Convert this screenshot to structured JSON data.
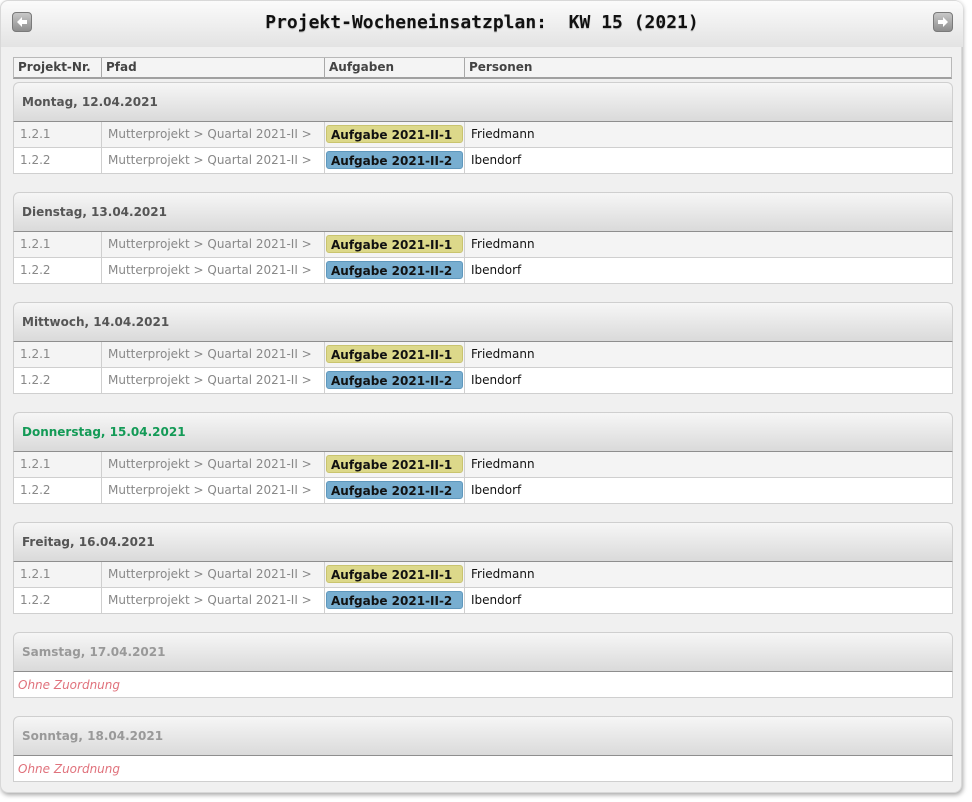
{
  "header": {
    "title": "Projekt-Wocheneinsatzplan:  KW 15 (2021)"
  },
  "columns": [
    "Projekt-Nr.",
    "Pfad",
    "Aufgaben",
    "Personen"
  ],
  "colors": {
    "today": "#139a56",
    "empty_text": "#e0727c",
    "task_yellow": "#dcd88a",
    "task_blue": "#78aed0"
  },
  "days": [
    {
      "label": "Montag, 12.04.2021",
      "rows": [
        {
          "nr": "1.2.1",
          "pfad": "Mutterprojekt > Quartal 2021-II >",
          "aufgabe": "Aufgabe 2021-II-1",
          "person": "Friedmann"
        },
        {
          "nr": "1.2.2",
          "pfad": "Mutterprojekt > Quartal 2021-II >",
          "aufgabe": "Aufgabe 2021-II-2",
          "person": "Ibendorf"
        }
      ]
    },
    {
      "label": "Dienstag, 13.04.2021",
      "rows": [
        {
          "nr": "1.2.1",
          "pfad": "Mutterprojekt > Quartal 2021-II >",
          "aufgabe": "Aufgabe 2021-II-1",
          "person": "Friedmann"
        },
        {
          "nr": "1.2.2",
          "pfad": "Mutterprojekt > Quartal 2021-II >",
          "aufgabe": "Aufgabe 2021-II-2",
          "person": "Ibendorf"
        }
      ]
    },
    {
      "label": "Mittwoch, 14.04.2021",
      "rows": [
        {
          "nr": "1.2.1",
          "pfad": "Mutterprojekt > Quartal 2021-II >",
          "aufgabe": "Aufgabe 2021-II-1",
          "person": "Friedmann"
        },
        {
          "nr": "1.2.2",
          "pfad": "Mutterprojekt > Quartal 2021-II >",
          "aufgabe": "Aufgabe 2021-II-2",
          "person": "Ibendorf"
        }
      ]
    },
    {
      "label": "Donnerstag, 15.04.2021",
      "rows": [
        {
          "nr": "1.2.1",
          "pfad": "Mutterprojekt > Quartal 2021-II >",
          "aufgabe": "Aufgabe 2021-II-1",
          "person": "Friedmann"
        },
        {
          "nr": "1.2.2",
          "pfad": "Mutterprojekt > Quartal 2021-II >",
          "aufgabe": "Aufgabe 2021-II-2",
          "person": "Ibendorf"
        }
      ]
    },
    {
      "label": "Freitag, 16.04.2021",
      "rows": [
        {
          "nr": "1.2.1",
          "pfad": "Mutterprojekt > Quartal 2021-II >",
          "aufgabe": "Aufgabe 2021-II-1",
          "person": "Friedmann"
        },
        {
          "nr": "1.2.2",
          "pfad": "Mutterprojekt > Quartal 2021-II >",
          "aufgabe": "Aufgabe 2021-II-2",
          "person": "Ibendorf"
        }
      ]
    },
    {
      "label": "Samstag, 17.04.2021",
      "empty_text": "Ohne Zuordnung"
    },
    {
      "label": "Sonntag, 18.04.2021",
      "empty_text": "Ohne Zuordnung"
    }
  ]
}
